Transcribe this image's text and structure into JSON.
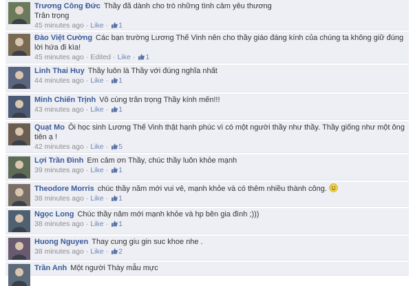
{
  "like_label": "Like",
  "separator": "·",
  "comments": [
    {
      "author": "Trương Công Đức",
      "text": "Thầy đã dành cho trò những tình cảm yêu thương\nTrân trọng",
      "time": "45 minutes ago",
      "edited": "",
      "likes": "1"
    },
    {
      "author": "Đào Việt Cường",
      "text": "Các bạn trường Lương Thế Vinh nên cho thầy giáo đáng kính của chúng ta không giữ đúng lời hứa đi kìa!",
      "time": "45 minutes ago",
      "edited": "Edited",
      "likes": "1"
    },
    {
      "author": "Linh Thai Huy",
      "text": "Thầy luôn là Thầy với đúng nghĩa nhất",
      "time": "44 minutes ago",
      "edited": "",
      "likes": "1"
    },
    {
      "author": "Minh Chiến Trịnh",
      "text": "Vô cùng trân trọng Thầy kính mến!!!",
      "time": "43 minutes ago",
      "edited": "",
      "likes": "1"
    },
    {
      "author": "Quạt Mo",
      "text": "Ôi học sinh Lương Thế Vinh thật hạnh phúc vì có một người thầy như thầy. Thầy giống như một ông tiên ạ !",
      "time": "42 minutes ago",
      "edited": "",
      "likes": "5"
    },
    {
      "author": "Lợi Trần Đình",
      "text": "Em cảm ơn Thầy, chúc thầy luôn khỏe mạnh",
      "time": "39 minutes ago",
      "edited": "",
      "likes": "1"
    },
    {
      "author": "Theodore Morris",
      "text": "chúc thầy năm mới vui vẻ, mạnh khỏe và có thêm nhiều thành công.",
      "time": "38 minutes ago",
      "edited": "",
      "likes": "1",
      "smiley": true
    },
    {
      "author": "Ngọc Long",
      "text": "Chúc thầy năm mới mạnh khỏe và hp bên gia đình ;)))",
      "time": "38 minutes ago",
      "edited": "",
      "likes": "1"
    },
    {
      "author": "Huong Nguyen",
      "text": "Thay cung giu gin suc khoe nhe .",
      "time": "38 minutes ago",
      "edited": "",
      "likes": "2"
    },
    {
      "author": "Trần Anh",
      "text": "Một người Thày mẫu mực",
      "time": "",
      "edited": "",
      "likes": ""
    }
  ]
}
